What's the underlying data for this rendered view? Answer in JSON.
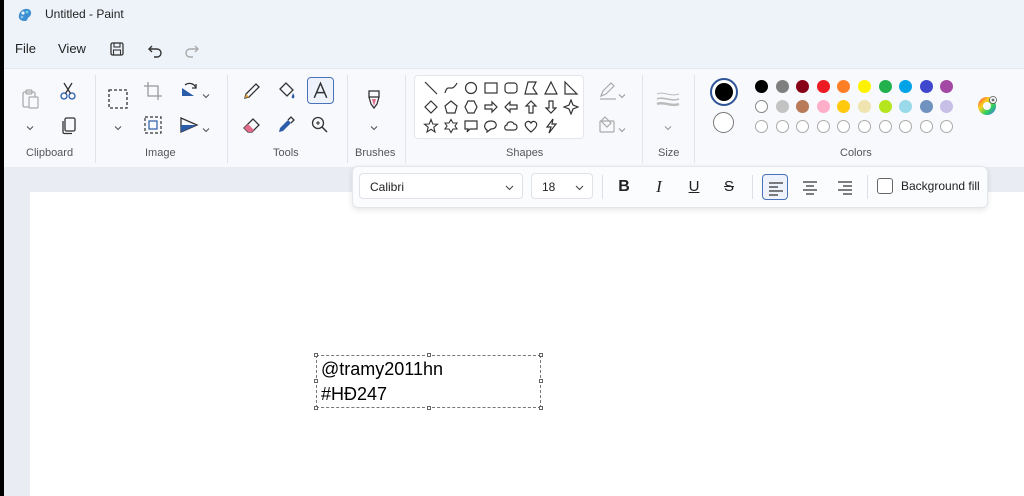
{
  "window": {
    "title": "Untitled - Paint"
  },
  "menu": {
    "file": "File",
    "view": "View"
  },
  "quick_access": {
    "save_icon": "save-icon",
    "undo_icon": "undo-icon",
    "redo_icon": "redo-icon"
  },
  "ribbon": {
    "groups": {
      "clipboard": "Clipboard",
      "image": "Image",
      "tools": "Tools",
      "brushes": "Brushes",
      "shapes": "Shapes",
      "size": "Size",
      "colors": "Colors"
    }
  },
  "colors": {
    "primary": "#000000",
    "secondary": "#ffffff",
    "palette_row1": [
      "#000000",
      "#7f7f7f",
      "#880015",
      "#ed1c24",
      "#ff7f27",
      "#fff200",
      "#22b14c",
      "#00a2e8",
      "#3f48cc",
      "#a349a4"
    ],
    "palette_row2": [
      "#ffffff",
      "#c3c3c3",
      "#b97a57",
      "#ffaec9",
      "#ffc90e",
      "#efe4b0",
      "#b5e61d",
      "#99d9ea",
      "#7092be",
      "#c8bfe7"
    ]
  },
  "text_toolbar": {
    "font": "Calibri",
    "size": "18",
    "bold": "B",
    "italic": "I",
    "underline": "U",
    "strikethrough": "S",
    "background_fill": "Background fill"
  },
  "canvas_text": {
    "line1": "@tramy2011hn",
    "line2": "#HĐ247"
  }
}
